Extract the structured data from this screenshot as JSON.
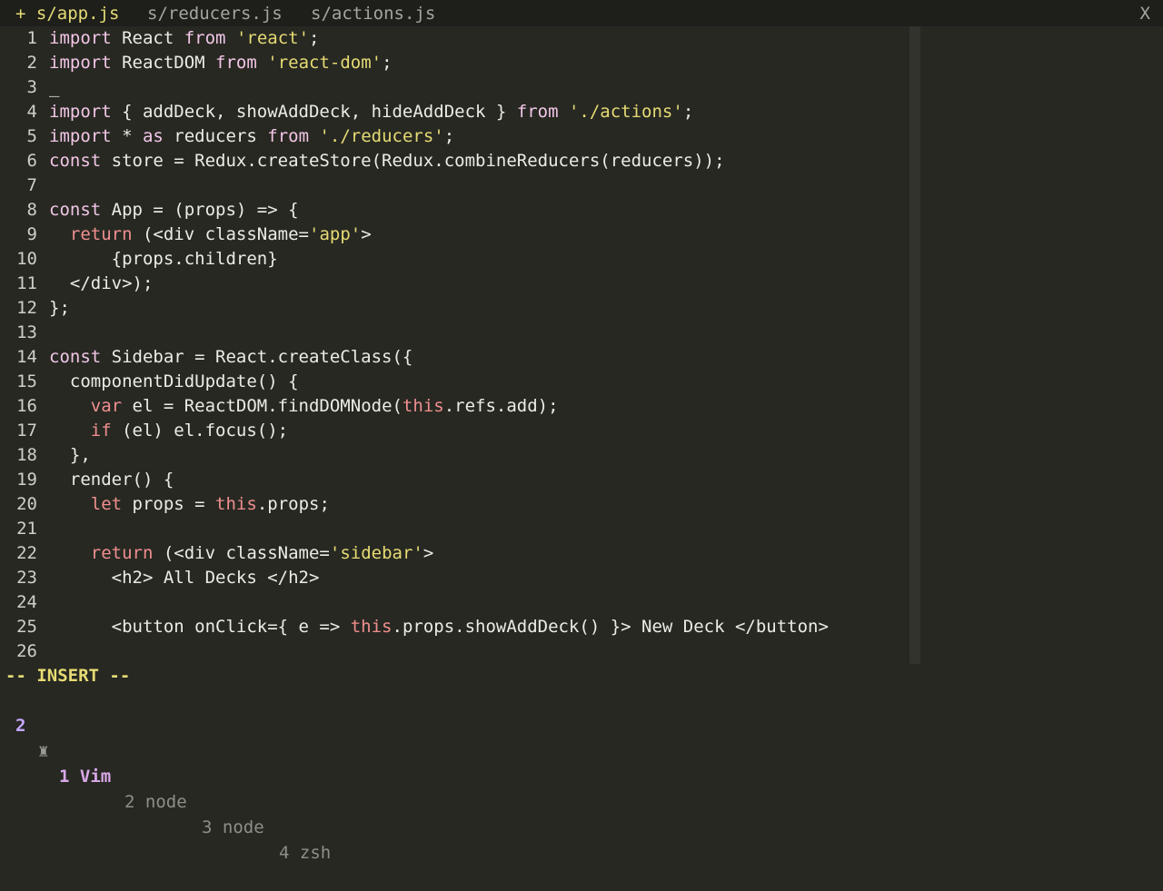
{
  "tabline": {
    "tabs": [
      {
        "label": "+ s/app.js",
        "active": true
      },
      {
        "label": "s/reducers.js",
        "active": false
      },
      {
        "label": "s/actions.js",
        "active": false
      }
    ],
    "close_label": "X"
  },
  "editor": {
    "lines": [
      {
        "n": "1",
        "segs": [
          {
            "t": "import",
            "c": "kw"
          },
          {
            "t": " React "
          },
          {
            "t": "from",
            "c": "kw"
          },
          {
            "t": " "
          },
          {
            "t": "'react'",
            "c": "str"
          },
          {
            "t": ";"
          }
        ]
      },
      {
        "n": "2",
        "segs": [
          {
            "t": "import",
            "c": "kw"
          },
          {
            "t": " ReactDOM "
          },
          {
            "t": "from",
            "c": "kw"
          },
          {
            "t": " "
          },
          {
            "t": "'react-dom'",
            "c": "str"
          },
          {
            "t": ";"
          }
        ]
      },
      {
        "n": "3",
        "segs": [
          {
            "t": "_",
            "c": "cursor"
          }
        ]
      },
      {
        "n": "4",
        "segs": [
          {
            "t": "import",
            "c": "kw"
          },
          {
            "t": " { addDeck, showAddDeck, hideAddDeck } "
          },
          {
            "t": "from",
            "c": "kw"
          },
          {
            "t": " "
          },
          {
            "t": "'./actions'",
            "c": "str"
          },
          {
            "t": ";"
          }
        ]
      },
      {
        "n": "5",
        "segs": [
          {
            "t": "import",
            "c": "kw"
          },
          {
            "t": " * "
          },
          {
            "t": "as",
            "c": "kw"
          },
          {
            "t": " reducers "
          },
          {
            "t": "from",
            "c": "kw"
          },
          {
            "t": " "
          },
          {
            "t": "'./reducers'",
            "c": "str"
          },
          {
            "t": ";"
          }
        ]
      },
      {
        "n": "6",
        "segs": [
          {
            "t": "const",
            "c": "kw"
          },
          {
            "t": " store = Redux.createStore(Redux.combineReducers(reducers));"
          }
        ]
      },
      {
        "n": "7",
        "segs": []
      },
      {
        "n": "8",
        "segs": [
          {
            "t": "const",
            "c": "kw"
          },
          {
            "t": " App = (props) => {"
          }
        ]
      },
      {
        "n": "9",
        "segs": [
          {
            "t": "  "
          },
          {
            "t": "return",
            "c": "kw2"
          },
          {
            "t": " (<div className="
          },
          {
            "t": "'app'",
            "c": "str"
          },
          {
            "t": ">"
          }
        ]
      },
      {
        "n": "10",
        "segs": [
          {
            "t": "      {props.children}"
          }
        ]
      },
      {
        "n": "11",
        "segs": [
          {
            "t": "  </div>);"
          }
        ]
      },
      {
        "n": "12",
        "segs": [
          {
            "t": "};"
          }
        ]
      },
      {
        "n": "13",
        "segs": []
      },
      {
        "n": "14",
        "segs": [
          {
            "t": "const",
            "c": "kw"
          },
          {
            "t": " Sidebar = React.createClass({"
          }
        ]
      },
      {
        "n": "15",
        "segs": [
          {
            "t": "  componentDidUpdate() {"
          }
        ]
      },
      {
        "n": "16",
        "segs": [
          {
            "t": "    "
          },
          {
            "t": "var",
            "c": "kw2"
          },
          {
            "t": " el = ReactDOM.findDOMNode("
          },
          {
            "t": "this",
            "c": "kw2"
          },
          {
            "t": ".refs.add);"
          }
        ]
      },
      {
        "n": "17",
        "segs": [
          {
            "t": "    "
          },
          {
            "t": "if",
            "c": "kw2"
          },
          {
            "t": " (el) el.focus();"
          }
        ]
      },
      {
        "n": "18",
        "segs": [
          {
            "t": "  },"
          }
        ]
      },
      {
        "n": "19",
        "segs": [
          {
            "t": "  render() {"
          }
        ]
      },
      {
        "n": "20",
        "segs": [
          {
            "t": "    "
          },
          {
            "t": "let",
            "c": "kw2"
          },
          {
            "t": " props = "
          },
          {
            "t": "this",
            "c": "kw2"
          },
          {
            "t": ".props;"
          }
        ]
      },
      {
        "n": "21",
        "segs": []
      },
      {
        "n": "22",
        "segs": [
          {
            "t": "    "
          },
          {
            "t": "return",
            "c": "kw2"
          },
          {
            "t": " (<div className="
          },
          {
            "t": "'sidebar'",
            "c": "str"
          },
          {
            "t": ">"
          }
        ]
      },
      {
        "n": "23",
        "segs": [
          {
            "t": "      <h2> All Decks </h2>"
          }
        ]
      },
      {
        "n": "24",
        "segs": []
      },
      {
        "n": "25",
        "segs": [
          {
            "t": "      <button onClick={ e => "
          },
          {
            "t": "this",
            "c": "kw2"
          },
          {
            "t": ".props.showAddDeck() }> New Deck </button>"
          }
        ]
      },
      {
        "n": "26",
        "segs": []
      }
    ]
  },
  "modeline": {
    "text": "-- INSERT --"
  },
  "status": {
    "session": "2",
    "icon": "♜",
    "active_window": "1 Vim",
    "windows": [
      "2 node",
      "3 node",
      "4 zsh"
    ]
  },
  "colors": {
    "background": "#272822",
    "keyword": "#f2c6e6",
    "keyword_alt": "#f08f8f",
    "string": "#e6db74",
    "mode": "#e6db74"
  }
}
